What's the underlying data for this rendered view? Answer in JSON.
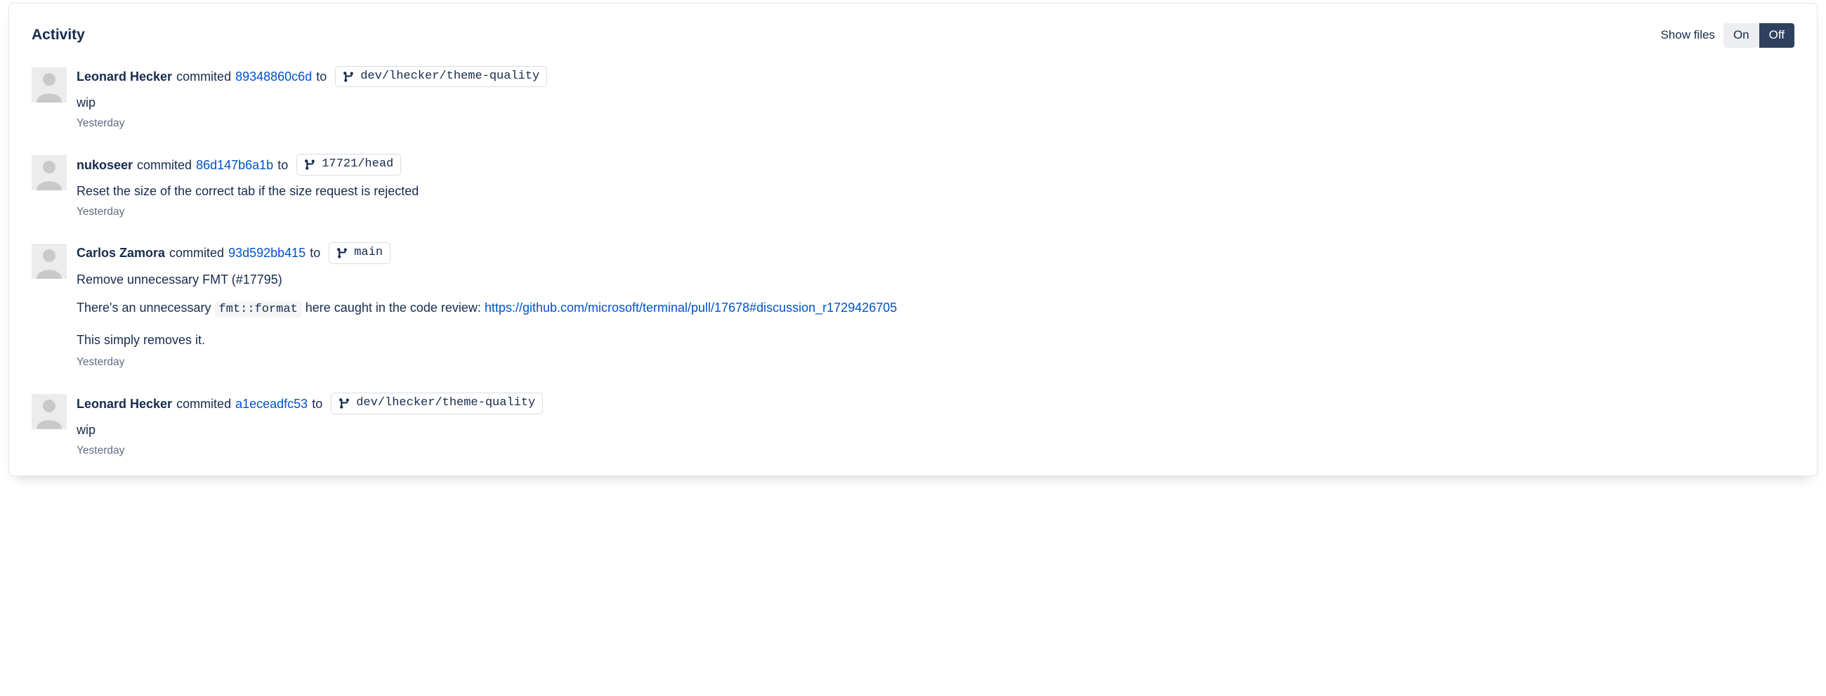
{
  "header": {
    "title": "Activity",
    "show_files_label": "Show files",
    "toggle_on": "On",
    "toggle_off": "Off"
  },
  "commit_verb": "commited",
  "to_word": "to",
  "activities": [
    {
      "author": "Leonard Hecker",
      "hash": "89348860c6d",
      "branch": "dev/lhecker/theme-quality",
      "title": "wip",
      "timestamp": "Yesterday"
    },
    {
      "author": "nukoseer",
      "hash": "86d147b6a1b",
      "branch": "17721/head",
      "title": "Reset the size of the correct tab if the size request is rejected",
      "timestamp": "Yesterday"
    },
    {
      "author": "Carlos Zamora",
      "hash": "93d592bb415",
      "branch": "main",
      "title": "Remove unnecessary FMT (#17795)",
      "desc1_pre": "There's an unnecessary ",
      "desc1_code": "fmt::format",
      "desc1_post": " here caught in the code review: ",
      "desc1_link": "https://github.com/microsoft/terminal/pull/17678#discussion_r1729426705",
      "desc2": "This simply removes it.",
      "timestamp": "Yesterday"
    },
    {
      "author": "Leonard Hecker",
      "hash": "a1eceadfc53",
      "branch": "dev/lhecker/theme-quality",
      "title": "wip",
      "timestamp": "Yesterday"
    }
  ]
}
